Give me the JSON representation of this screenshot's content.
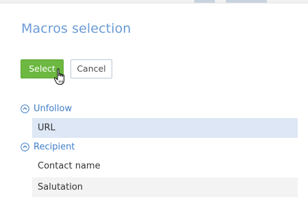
{
  "dialog": {
    "title": "Macros selection"
  },
  "toolbar": {
    "select_label": "Select",
    "cancel_label": "Cancel"
  },
  "groups": [
    {
      "label": "Unfollow",
      "icon": "chevron-up-circle-icon",
      "items": [
        {
          "label": "URL",
          "selected": true
        }
      ]
    },
    {
      "label": "Recipient",
      "icon": "chevron-up-circle-icon",
      "items": [
        {
          "label": "Contact name",
          "selected": false
        },
        {
          "label": "Salutation",
          "selected": false
        }
      ]
    }
  ],
  "colors": {
    "title": "#6a9ad7",
    "select_button": "#6cb840",
    "group_label": "#3f7dc8",
    "selected_row": "#dde7f5",
    "alt_row": "#f3f3f3"
  },
  "cursor": "hand-pointer-icon"
}
